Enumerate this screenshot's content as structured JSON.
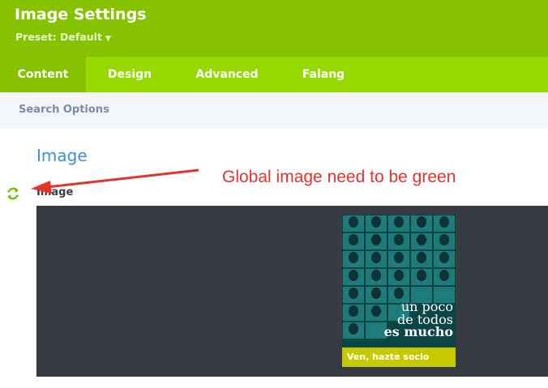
{
  "header": {
    "title": "Image Settings",
    "preset": "Preset: Default"
  },
  "tabs": [
    {
      "label": "Content",
      "active": true
    },
    {
      "label": "Design",
      "active": false
    },
    {
      "label": "Advanced",
      "active": false
    },
    {
      "label": "Falang",
      "active": false
    }
  ],
  "search": {
    "placeholder": "Search Options"
  },
  "section": {
    "title": "Image"
  },
  "field": {
    "label": "Image",
    "icon": "sync-icon"
  },
  "preview": {
    "headline_line1": "un poco",
    "headline_line2": "de todos",
    "headline_line3": "es mucho",
    "cta": "Ven, hazte socio"
  },
  "annotation": {
    "text": "Global image need to be green",
    "color": "#e5322b"
  },
  "colors": {
    "header": "#86c200",
    "tabs": "#97d800",
    "accent_blue": "#3d8fd6",
    "preview_bg": "#363b43"
  }
}
